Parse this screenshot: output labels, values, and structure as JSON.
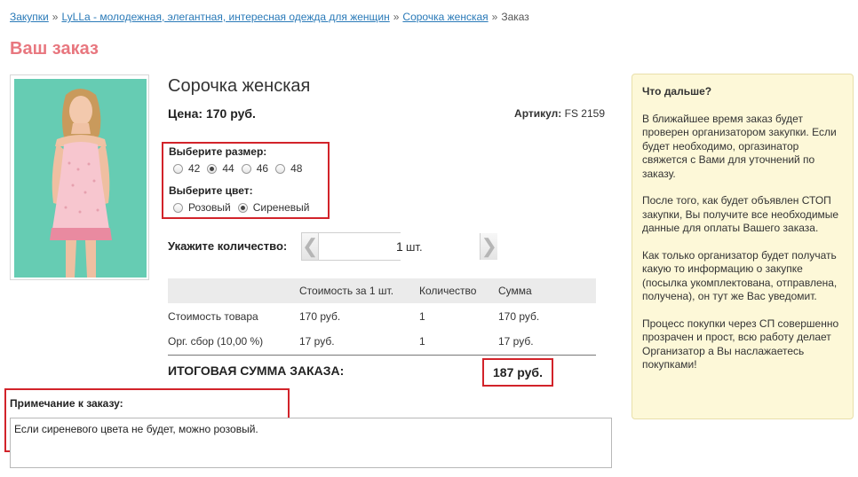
{
  "breadcrumb": {
    "items": [
      "Закупки",
      "LyLLa - молодежная, элегантная, интересная одежда для женщин",
      "Сорочка женская"
    ],
    "separator": "»",
    "current": "Заказ"
  },
  "page_title": "Ваш заказ",
  "product": {
    "name": "Сорочка женская",
    "price": "Цена: 170 руб.",
    "article_label": "Артикул:",
    "article_value": "FS 2159"
  },
  "options": {
    "size_label": "Выберите размер:",
    "sizes": [
      "42",
      "44",
      "46",
      "48"
    ],
    "selected_size": "44",
    "color_label": "Выберите цвет:",
    "colors": [
      "Розовый",
      "Сиреневый"
    ],
    "selected_color": "Сиреневый"
  },
  "quantity": {
    "label": "Укажите количество:",
    "value": "1",
    "unit": "шт."
  },
  "cost_table": {
    "headers": [
      "",
      "Стоимость за 1 шт.",
      "Количество",
      "Сумма"
    ],
    "rows": [
      [
        "Стоимость товара",
        "170 руб.",
        "1",
        "170 руб."
      ],
      [
        "Орг. сбор (10,00 %)",
        "17 руб.",
        "1",
        "17 руб."
      ]
    ]
  },
  "total": {
    "label": "ИТОГОВАЯ СУММА ЗАКАЗА:",
    "value": "187 руб."
  },
  "note": {
    "label": "Примечание к заказу:",
    "value": "Если сиреневого цвета не будет, можно розовый."
  },
  "info": {
    "title": "Что дальше?",
    "paragraphs": [
      "В ближайшее время заказ будет проверен организатором закупки. Если будет необходимо, оргазинатор свяжется с Вами для уточнений по заказу.",
      "После того, как будет объявлен СТОП закупки, Вы получите все необходимые данные для оплаты Вашего заказа.",
      "Как только организатор будет получать какую то информацию о закупке (посылка укомплектована, отправлена, получена), он тут же Вас уведомит.",
      "Процесс покупки через СП совершенно прозрачен и прост, всю работу делает Организатор а Вы наслажаетесь покупками!"
    ]
  },
  "colors": {
    "link": "#2a7ab8",
    "title": "#e8777f",
    "highlight_border": "#d2232a",
    "info_bg": "#fdf8d8",
    "photo_bg": "#66ccb3"
  }
}
